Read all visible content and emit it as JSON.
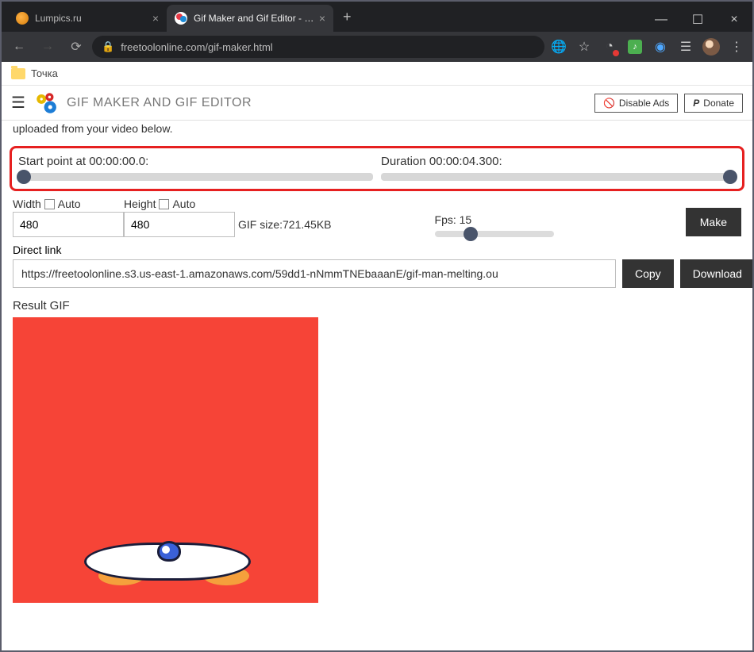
{
  "browser": {
    "tabs": [
      {
        "title": "Lumpics.ru"
      },
      {
        "title": "Gif Maker and Gif Editor - Free Tc"
      }
    ],
    "url": "freetoolonline.com/gif-maker.html",
    "bookmark": "Точка"
  },
  "header": {
    "title": "GIF MAKER AND GIF EDITOR",
    "disable_ads": "Disable Ads",
    "donate": "Donate"
  },
  "faded_line": {
    "prefix": "uploaded from your video below."
  },
  "sliders": {
    "start_label": "Start point at 00:00:00.0:",
    "duration_label": "Duration 00:00:04.300:"
  },
  "dims": {
    "width_label": "Width",
    "height_label": "Height",
    "auto_label": "Auto",
    "width_value": "480",
    "height_value": "480",
    "gif_size": "GIF size:721.45KB"
  },
  "fps": {
    "label": "Fps: 15"
  },
  "buttons": {
    "make": "Make",
    "copy": "Copy",
    "download": "Download"
  },
  "direct": {
    "label": "Direct link",
    "value": "https://freetoolonline.s3.us-east-1.amazonaws.com/59dd1-nNmmTNEbaaanE/gif-man-melting.ou"
  },
  "result": {
    "label": "Result GIF"
  }
}
